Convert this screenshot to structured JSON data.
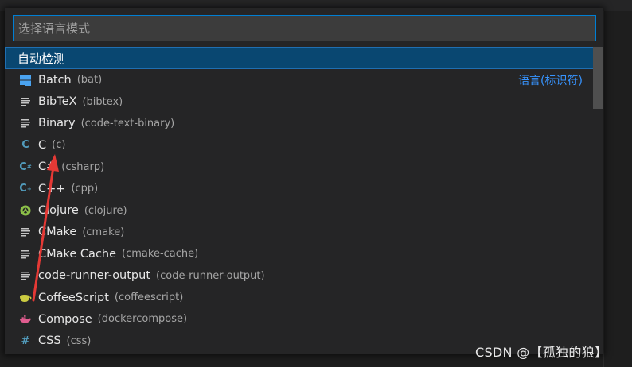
{
  "quick_pick": {
    "placeholder": "选择语言模式",
    "header_label": "自动检测",
    "items": [
      {
        "name": "Batch",
        "id": "(bat)",
        "icon": "windows-icon",
        "right": "语言(标识符)"
      },
      {
        "name": "BibTeX",
        "id": "(bibtex)",
        "icon": "lines-icon"
      },
      {
        "name": "Binary",
        "id": "(code-text-binary)",
        "icon": "lines-icon"
      },
      {
        "name": "C",
        "id": "(c)",
        "icon": "c-icon"
      },
      {
        "name": "C#",
        "id": "(csharp)",
        "icon": "csharp-icon"
      },
      {
        "name": "C++",
        "id": "(cpp)",
        "icon": "cpp-icon"
      },
      {
        "name": "Clojure",
        "id": "(clojure)",
        "icon": "clojure-icon"
      },
      {
        "name": "CMake",
        "id": "(cmake)",
        "icon": "lines-icon"
      },
      {
        "name": "CMake Cache",
        "id": "(cmake-cache)",
        "icon": "lines-icon"
      },
      {
        "name": "code-runner-output",
        "id": "(code-runner-output)",
        "icon": "lines-icon"
      },
      {
        "name": "CoffeeScript",
        "id": "(coffeescript)",
        "icon": "coffee-icon"
      },
      {
        "name": "Compose",
        "id": "(dockercompose)",
        "icon": "docker-icon"
      },
      {
        "name": "CSS",
        "id": "(css)",
        "icon": "hash-icon"
      }
    ]
  },
  "watermark": "CSDN @【孤独的狼】",
  "colors": {
    "accent": "#3794ff",
    "selection": "#094771",
    "annotation_arrow": "#e53935"
  }
}
